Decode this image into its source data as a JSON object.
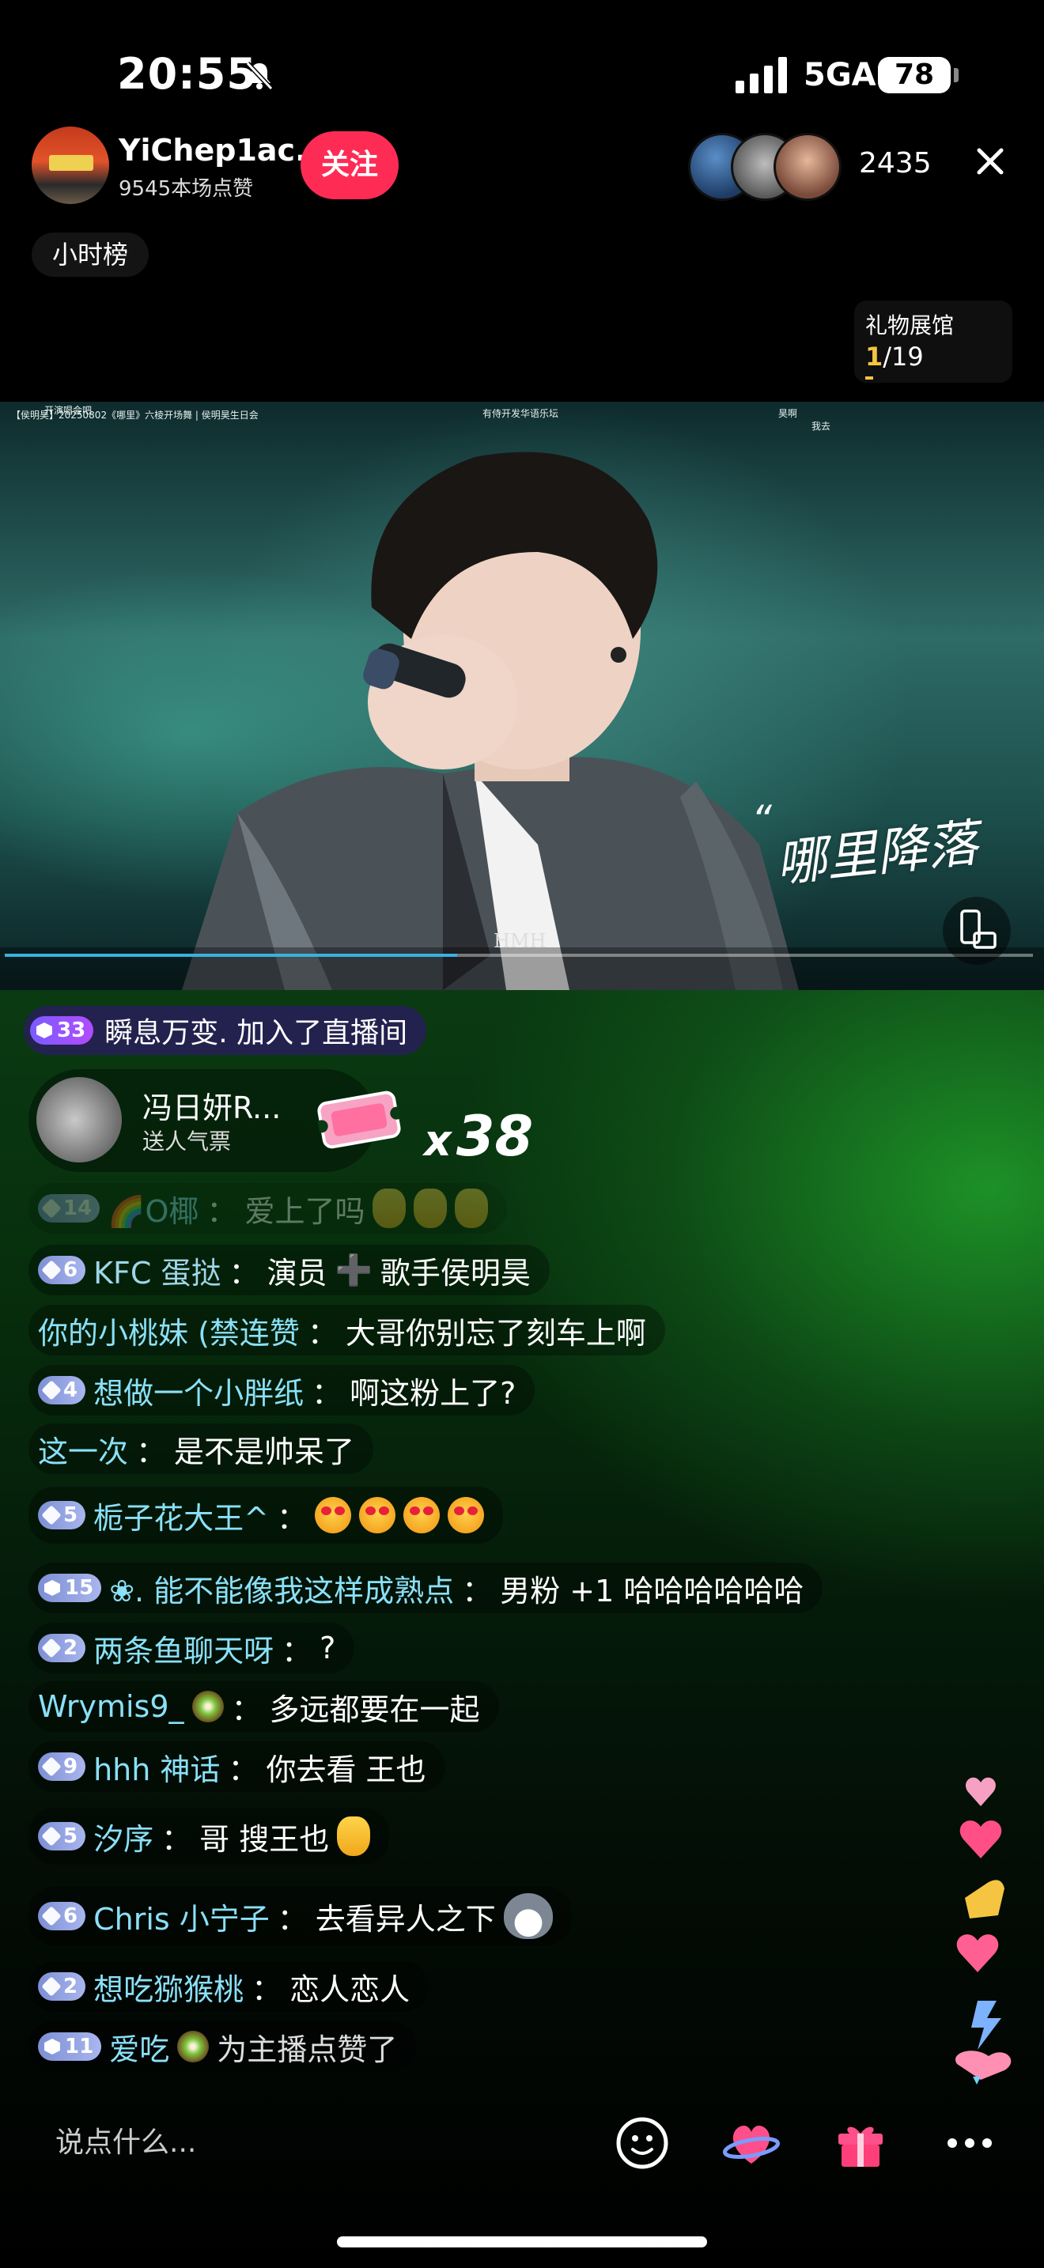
{
  "status_bar": {
    "time": "20:55",
    "network": "5GA",
    "battery": "78"
  },
  "host": {
    "name": "YiChep1ac...",
    "likes_text": "9545本场点赞",
    "follow_label": "关注"
  },
  "viewers": {
    "count": "2435"
  },
  "hour_rank_label": "小时榜",
  "gift_hall": {
    "title": "礼物展馆",
    "current": "1",
    "total": "/19"
  },
  "video": {
    "top_text": "【侯明昊】20250802《哪里》六棱开场舞 | 侯明昊生日会",
    "tag_1": "开演唱会吧",
    "tag_2": "有侍开发华语乐坛",
    "tag_3": "昊啊",
    "tag_4": "我去",
    "caption": "哪里降落",
    "watermark": "HMH",
    "progress": 0.44
  },
  "join_notice": {
    "level": "33",
    "text": "瞬息万变. 加入了直播间"
  },
  "gift": {
    "user": "冯日妍R...",
    "desc": "送人气票",
    "multiplier": "x",
    "count": "38"
  },
  "messages": [
    {
      "level": "14",
      "name": "🌈O椰",
      "body": "爱上了吗",
      "faded": true
    },
    {
      "level": "6",
      "name": "KFC 蛋挞",
      "body_a": "演员",
      "body_b": "歌手侯明昊"
    },
    {
      "name": "你的小桃妹 (禁连赞",
      "body": "大哥你别忘了刻车上啊"
    },
    {
      "level": "4",
      "name": "想做一个小胖纸",
      "body": "啊这粉上了?"
    },
    {
      "name": "这一次",
      "body": "是不是帅呆了"
    },
    {
      "level": "5",
      "name": "栀子花大王^"
    },
    {
      "level": "15",
      "name": "❀. 能不能像我这样成熟点",
      "body": "男粉 +1 哈哈哈哈哈哈"
    },
    {
      "level": "2",
      "name": "两条鱼聊天呀",
      "body": "?"
    },
    {
      "name": "Wrymis9_",
      "body": "多远都要在一起"
    },
    {
      "level": "9",
      "name": "hhh 神话",
      "body": "你去看  王也"
    },
    {
      "level": "5",
      "name": "汐序",
      "body": "哥 搜王也"
    },
    {
      "level": "6",
      "name": "Chris 小宁子",
      "body": "去看异人之下"
    },
    {
      "level": "2",
      "name": "想吃猕猴桃",
      "body": "恋人恋人"
    },
    {
      "level": "11",
      "name": "爱吃",
      "body": "为主播点赞了"
    }
  ],
  "separator": "：",
  "bottom_bar": {
    "placeholder": "说点什么..."
  },
  "icons": {
    "bell": "bell-slash-icon",
    "close": "close-icon",
    "rotate": "rotate-screen-icon",
    "emoji": "emoji-icon",
    "like": "heart-planet-icon",
    "gift": "gift-box-icon",
    "more": "more-dots-icon"
  },
  "colors": {
    "follow": "#fe2c55",
    "name": "#8ae0f8",
    "gold": "#f5c542"
  }
}
